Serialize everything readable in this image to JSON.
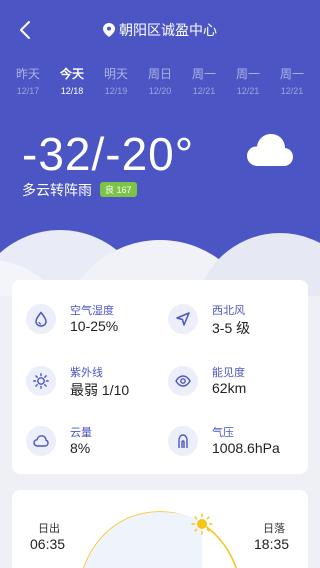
{
  "header": {
    "location": "朝阳区诚盈中心"
  },
  "days": [
    {
      "name": "昨天",
      "date": "12/17",
      "active": false
    },
    {
      "name": "今天",
      "date": "12/18",
      "active": true
    },
    {
      "name": "明天",
      "date": "12/19",
      "active": false
    },
    {
      "name": "周日",
      "date": "12/20",
      "active": false
    },
    {
      "name": "周一",
      "date": "12/21",
      "active": false
    },
    {
      "name": "周一",
      "date": "12/21",
      "active": false
    },
    {
      "name": "周一",
      "date": "12/21",
      "active": false
    }
  ],
  "current": {
    "temp": "-32/-20°",
    "condition": "多云转阵雨",
    "aqi": "良 167"
  },
  "stats": [
    {
      "label": "空气湿度",
      "value": "10-25%",
      "icon": "droplet-icon"
    },
    {
      "label": "西北风",
      "value": "3-5 级",
      "icon": "wind-direction-icon"
    },
    {
      "label": "紫外线",
      "value": "最弱 1/10",
      "icon": "sun-uv-icon"
    },
    {
      "label": "能见度",
      "value": "62km",
      "icon": "eye-icon"
    },
    {
      "label": "云量",
      "value": "8%",
      "icon": "cloud-icon"
    },
    {
      "label": "气压",
      "value": "1008.6hPa",
      "icon": "pressure-icon"
    }
  ],
  "sun": {
    "sunrise_label": "日出",
    "sunrise_time": "06:35",
    "sunset_label": "日落",
    "sunset_time": "18:35"
  },
  "colors": {
    "primary": "#4b56c4",
    "aqi_good": "#7cc348",
    "sun": "#f5c518"
  }
}
